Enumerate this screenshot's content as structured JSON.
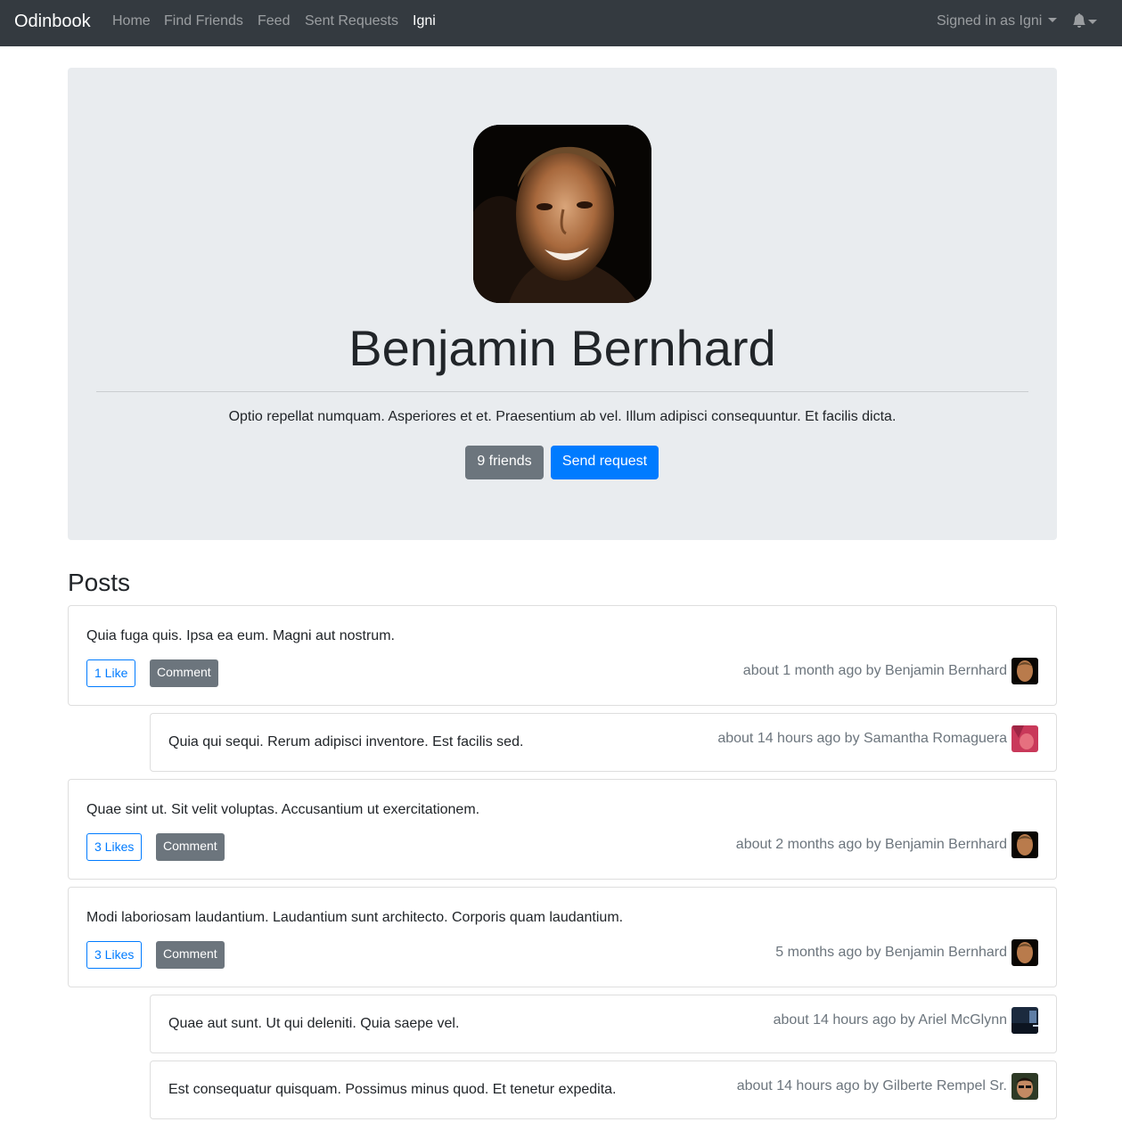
{
  "navbar": {
    "brand": "Odinbook",
    "links": [
      "Home",
      "Find Friends",
      "Feed",
      "Sent Requests",
      "Igni"
    ],
    "signed_in": "Signed in as Igni",
    "bell_icon": "bell-icon"
  },
  "profile": {
    "name": "Benjamin Bernhard",
    "bio": "Optio repellat numquam. Asperiores et et. Praesentium ab vel. Illum adipisci consequuntur. Et facilis dicta.",
    "friends_label": "9 friends",
    "send_request_label": "Send request"
  },
  "posts_title": "Posts",
  "posts": [
    {
      "text": "Quia fuga quis. Ipsa ea eum. Magni aut nostrum.",
      "likes": "1 Like",
      "comment_label": "Comment",
      "meta": "about 1 month ago by Benjamin Bernhard",
      "comments": [
        {
          "text": "Quia qui sequi. Rerum adipisci inventore. Est facilis sed.",
          "meta": "about 14 hours ago by Samantha Romaguera"
        }
      ]
    },
    {
      "text": "Quae sint ut. Sit velit voluptas. Accusantium ut exercitationem.",
      "likes": "3 Likes",
      "comment_label": "Comment",
      "meta": "about 2 months ago by Benjamin Bernhard",
      "comments": []
    },
    {
      "text": "Modi laboriosam laudantium. Laudantium sunt architecto. Corporis quam laudantium.",
      "likes": "3 Likes",
      "comment_label": "Comment",
      "meta": "5 months ago by Benjamin Bernhard",
      "comments": [
        {
          "text": "Quae aut sunt. Ut qui deleniti. Quia saepe vel.",
          "meta": "about 14 hours ago by Ariel McGlynn"
        },
        {
          "text": "Est consequatur quisquam. Possimus minus quod. Et tenetur expedita.",
          "meta": "about 14 hours ago by Gilberte Rempel Sr."
        }
      ]
    }
  ],
  "colors": {
    "navbar": "#343a40",
    "primary": "#007bff",
    "secondary": "#6c757d",
    "jumbotron": "#e9ecef"
  }
}
